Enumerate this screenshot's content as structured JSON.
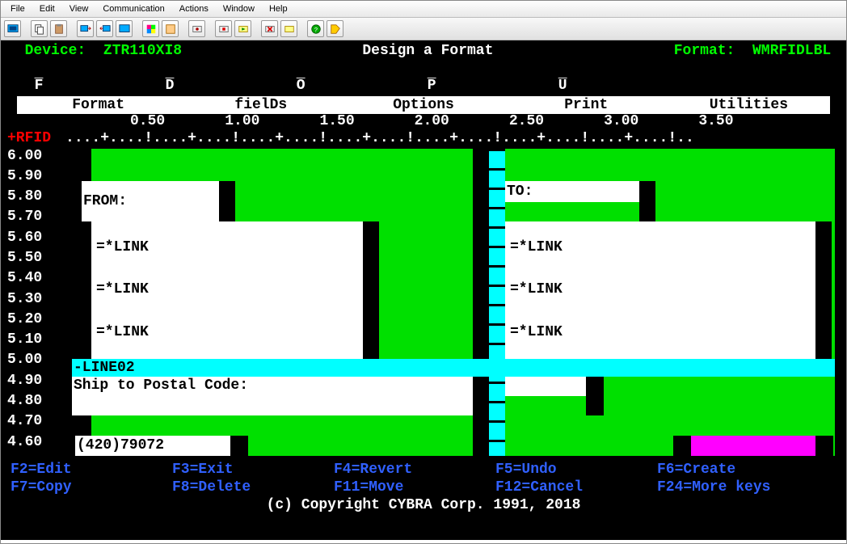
{
  "menubar": [
    "File",
    "Edit",
    "View",
    "Communication",
    "Actions",
    "Window",
    "Help"
  ],
  "title": {
    "device_label": "Device:",
    "device_value": "ZTR110XI8",
    "center": "Design a Format",
    "format_label": "Format:",
    "format_value": "WMRFIDLBL"
  },
  "tabs": [
    "Format",
    "fielDs",
    "Options",
    "Print",
    "Utilities"
  ],
  "ruler_marks": [
    "0.50",
    "1.00",
    "1.50",
    "2.00",
    "2.50",
    "3.00",
    "3.50"
  ],
  "rfid_label": "+RFID",
  "ruler_ticks": "....+....!....+....!....+....!....+....!....+....!....+....!....+....!..",
  "yvals": [
    "6.00",
    "5.90",
    "5.80",
    "5.70",
    "5.60",
    "5.50",
    "5.40",
    "5.30",
    "5.20",
    "5.10",
    "5.00",
    "4.90",
    "4.80",
    "4.70",
    "4.60"
  ],
  "fields": {
    "from": "FROM:",
    "to": "TO:",
    "link": "=*LINK",
    "line02": "-LINE02",
    "ship": "Ship to Postal Code:",
    "postal": "(420)79072"
  },
  "fnkeys": {
    "row1": [
      "F2=Edit",
      "F3=Exit",
      "F4=Revert",
      "F5=Undo",
      "F6=Create"
    ],
    "row2": [
      "F7=Copy",
      "F8=Delete",
      "F11=Move",
      "F12=Cancel",
      "F24=More keys"
    ]
  },
  "copyright": "(c) Copyright CYBRA Corp. 1991, 2018"
}
